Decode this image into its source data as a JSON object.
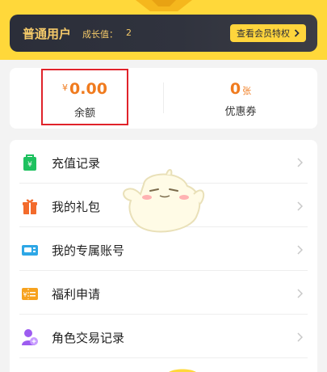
{
  "member": {
    "title": "普通用户",
    "growth_label": "成长值：",
    "growth_value": "2",
    "vip_button": "查看会员特权"
  },
  "balance": {
    "currency": "¥",
    "amount": "0.00",
    "label": "余额"
  },
  "coupon": {
    "count": "0",
    "unit": "张",
    "label": "优惠券"
  },
  "menu": {
    "items": [
      {
        "label": "充值记录",
        "icon": "recharge-bag-icon"
      },
      {
        "label": "我的礼包",
        "icon": "gift-icon"
      },
      {
        "label": "我的专属账号",
        "icon": "account-card-icon"
      },
      {
        "label": "福利申请",
        "icon": "welfare-ticket-icon"
      },
      {
        "label": "角色交易记录",
        "icon": "role-trade-icon"
      }
    ]
  },
  "colors": {
    "banner": "#ffd83a",
    "member_card": "#2b2e39",
    "gold_text": "#f4c969",
    "accent_orange": "#f07b1e",
    "highlight_red": "#e0232a"
  }
}
